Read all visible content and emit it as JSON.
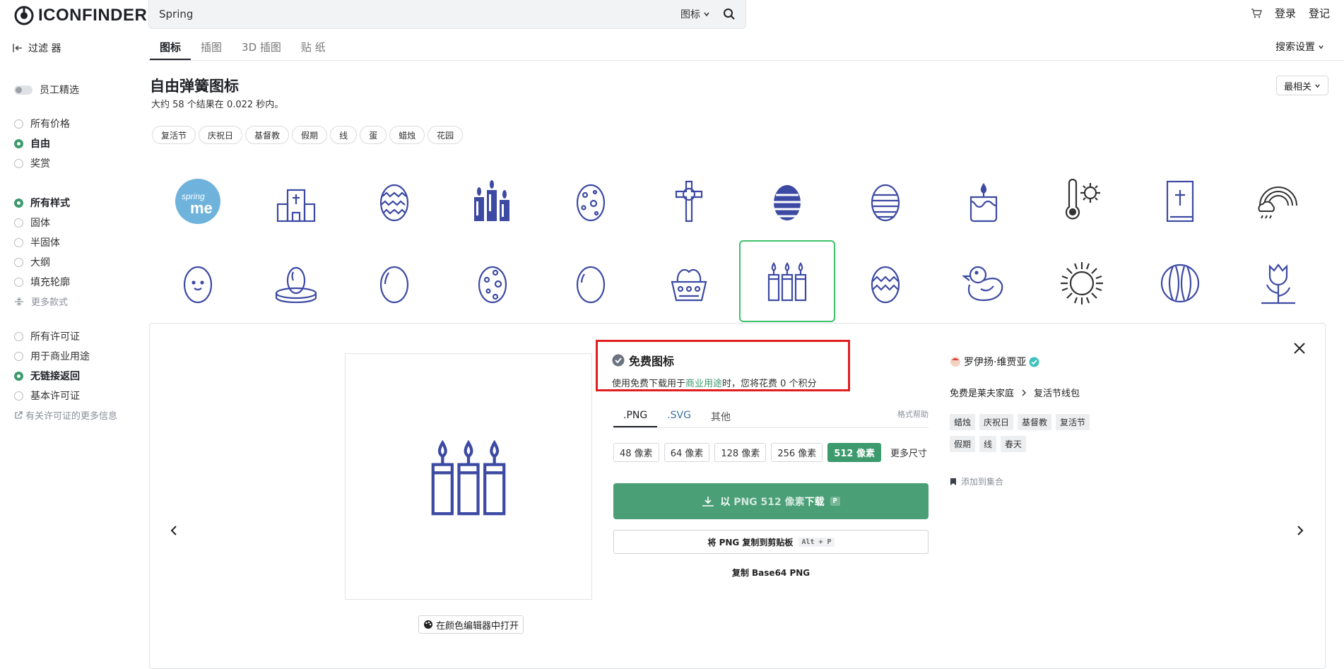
{
  "header": {
    "logo_text": "ICONFINDER",
    "search_value": "Spring",
    "search_type": "图标",
    "login": "登录",
    "signup": "登记"
  },
  "subbar": {
    "filter_label": "过滤 器",
    "tabs": [
      {
        "label": "图标",
        "active": true
      },
      {
        "label": "插图",
        "active": false
      },
      {
        "label": "3D 插图",
        "active": false
      },
      {
        "label": "贴 纸",
        "active": false
      }
    ],
    "search_settings": "搜索设置"
  },
  "sidebar": {
    "staff_pick": "员工精选",
    "price": [
      {
        "label": "所有价格",
        "on": false
      },
      {
        "label": "自由",
        "on": true
      },
      {
        "label": "奖赏",
        "on": false
      }
    ],
    "style": [
      {
        "label": "所有样式",
        "on": true
      },
      {
        "label": "固体",
        "on": false
      },
      {
        "label": "半固体",
        "on": false
      },
      {
        "label": "大纲",
        "on": false
      },
      {
        "label": "填充轮廓",
        "on": false
      }
    ],
    "more_styles": "更多款式",
    "license": [
      {
        "label": "所有许可证",
        "on": false
      },
      {
        "label": "用于商业用途",
        "on": false
      },
      {
        "label": "无链接返回",
        "on": true
      },
      {
        "label": "基本许可证",
        "on": false
      }
    ],
    "license_info": "有关许可证的更多信息"
  },
  "main": {
    "title": "自由弹簧图标",
    "result_text": "大约 58 个结果在 0.022 秒内。",
    "sort": "最相关",
    "tags": [
      "复活节",
      "庆祝日",
      "基督教",
      "假期",
      "线",
      "蛋",
      "蜡烛",
      "花园"
    ]
  },
  "icons_row1": [
    "springme-logo",
    "church-icon",
    "zigzag-egg-icon",
    "candles-icon",
    "dotted-egg-icon",
    "cross-icon",
    "striped-egg-icon",
    "lined-egg-icon",
    "candle-icon",
    "thermometer-sun-icon",
    "bible-icon",
    "rainbow-icon"
  ],
  "icons_row2": [
    "smiley-egg-icon",
    "egg-on-plate-icon",
    "egg-icon",
    "spotted-egg-icon",
    "plain-egg-icon",
    "egg-basket-icon",
    "three-candles-icon",
    "zigzag-egg-2-icon",
    "duck-icon",
    "sun-icon",
    "tulip-bulb-icon",
    "tulip-icon"
  ],
  "detail": {
    "open_editor": "在颜色编辑器中打开",
    "free_title": "免费图标",
    "free_desc_prefix": "使用免费下载用于",
    "free_desc_link": "商业用途",
    "free_desc_suffix": "时，您将花费 0 个积分",
    "format_tabs": [
      {
        "label": ".PNG",
        "active": true
      },
      {
        "label": ".SVG",
        "active": false
      },
      {
        "label": "其他",
        "active": false
      }
    ],
    "format_help": "格式帮助",
    "sizes": [
      {
        "label": "48 像素",
        "on": false
      },
      {
        "label": "64 像素",
        "on": false
      },
      {
        "label": "128 像素",
        "on": false
      },
      {
        "label": "256 像素",
        "on": false
      },
      {
        "label": "512 像素",
        "on": true
      }
    ],
    "more_sizes": "更多尺寸",
    "download_prefix": "以 ",
    "download_mid": "PNG 512 像素",
    "download_suffix": "下载",
    "download_key": "P",
    "copy_label": "将 PNG 复制到剪贴板",
    "copy_key": "Alt + P",
    "base64": "复制 Base64 PNG",
    "author": "罗伊扬·维贾亚",
    "family_label": "免费是莱夫家庭",
    "family_set": "复活节线包",
    "detail_tags": [
      "蜡烛",
      "庆祝日",
      "基督教",
      "复活节",
      "假期",
      "线",
      "春天"
    ],
    "add_collection": "添加到集合"
  },
  "colors": {
    "accent_green": "#3c9a6d",
    "button_green": "#4a9f76",
    "icon_blue": "#3d4aa3",
    "highlight_red": "#e01e1e",
    "selected_border": "#3ec26a"
  }
}
